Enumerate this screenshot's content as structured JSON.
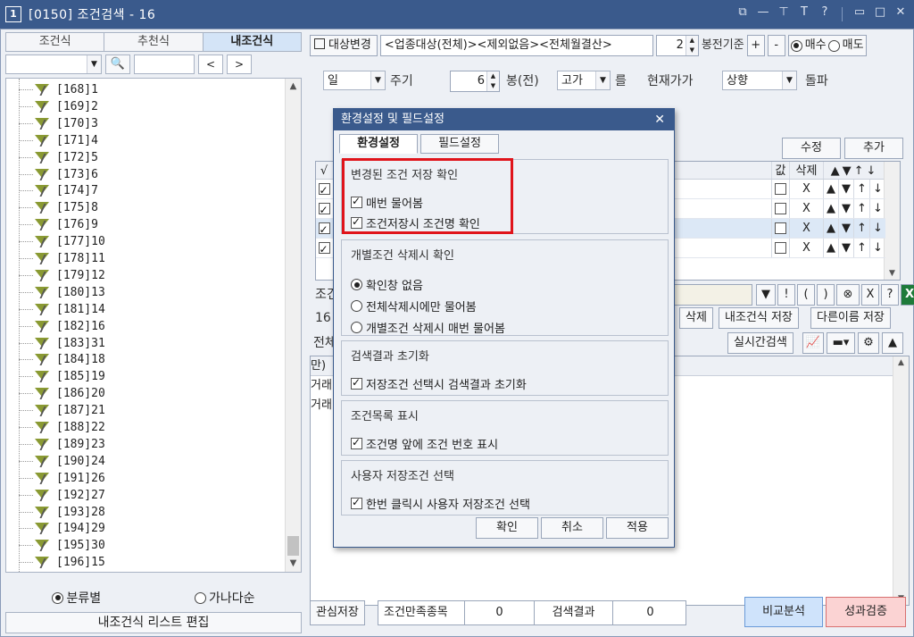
{
  "window": {
    "badge": "1",
    "title": "[0150] 조건검색 - 16",
    "controls": [
      "⧉",
      "—",
      "⊤",
      "T",
      "?",
      "▭",
      "□",
      "✕"
    ]
  },
  "left": {
    "tabs": [
      "조건식",
      "추천식",
      "내조건식"
    ],
    "search_glyph": "🔍",
    "nav_prev": "<",
    "nav_next": ">",
    "tree_items": [
      "[168]1",
      "[169]2",
      "[170]3",
      "[171]4",
      "[172]5",
      "[173]6",
      "[174]7",
      "[175]8",
      "[176]9",
      "[177]10",
      "[178]11",
      "[179]12",
      "[180]13",
      "[181]14",
      "[182]16",
      "[183]31",
      "[184]18",
      "[185]19",
      "[186]20",
      "[187]21",
      "[188]22",
      "[189]23",
      "[190]24",
      "[191]26",
      "[192]27",
      "[193]28",
      "[194]29",
      "[195]30",
      "[196]15"
    ],
    "radio_category": "분류별",
    "radio_alpha": "가나다순",
    "edit_button": "내조건식 리스트 편집"
  },
  "right": {
    "target_button": "대상변경",
    "target_desc": "<업종대상(전체)><제외없음><전체월결산>",
    "bong_value": "2",
    "bong_label": "봉전기준",
    "plus": "+",
    "minus": "-",
    "buy": "매수",
    "sell": "매도",
    "period_unit": "일",
    "period_label": "주기",
    "bong_count": "6",
    "bong_before_label": "봉(전)",
    "price_type": "고가",
    "eul": "를",
    "current_label": "현재가가",
    "direction": "상향",
    "break_label": "돌파",
    "modify_button": "수정",
    "add_button": "추가",
    "table_headers": {
      "check": "√",
      "value": "값",
      "delete": "삭제",
      "arrows": "▲▼↑↓"
    },
    "row_delete": "X",
    "row_arrows": [
      "▲",
      "▼",
      "↑",
      "↓"
    ],
    "cond_label": "조건",
    "cond_tools": [
      "▼",
      "!",
      "(",
      ")",
      "⊗",
      "X",
      "?"
    ],
    "cond_prefix": "16",
    "delete_button": "삭제",
    "save_button": "내조건식 저장",
    "save_as_button": "다른이름 저장",
    "all_label": "전체",
    "realtime_button": "실시간검색",
    "result_headers": [
      "만)",
      "거래량",
      "거래량전일비"
    ],
    "watch_save": "관심저장",
    "satisfy_label": "조건만족종목",
    "satisfy_value": "0",
    "result_label": "검색결과",
    "result_value": "0",
    "compare_button": "비교분석",
    "performance_button": "성과검증",
    "accent_colors": {
      "compare": "#cfe3fb",
      "performance": "#fbd3d3"
    }
  },
  "dialog": {
    "title": "환경설정 및 필드설정",
    "close": "✕",
    "tabs": [
      "환경설정",
      "필드설정"
    ],
    "groups": [
      {
        "title": "변경된 조건 저장 확인",
        "options": [
          {
            "label": "매번 물어봄",
            "checked": true
          },
          {
            "label": "조건저장시 조건명 확인",
            "checked": true
          }
        ]
      },
      {
        "title": "개별조건 삭제시 확인",
        "radios": [
          {
            "label": "확인창 없음",
            "selected": true
          },
          {
            "label": "전체삭제시에만 물어봄",
            "selected": false
          },
          {
            "label": "개별조건 삭제시 매번 물어봄",
            "selected": false
          }
        ]
      },
      {
        "title": "검색결과 초기화",
        "options": [
          {
            "label": "저장조건 선택시 검색결과 초기화",
            "checked": true
          }
        ]
      },
      {
        "title": "조건목록 표시",
        "options": [
          {
            "label": "조건명 앞에 조건 번호 표시",
            "checked": true
          }
        ]
      },
      {
        "title": "사용자 저장조건 선택",
        "options": [
          {
            "label": "한번 클릭시 사용자 저장조건 선택",
            "checked": true
          }
        ]
      }
    ],
    "buttons": [
      "확인",
      "취소",
      "적용"
    ]
  }
}
